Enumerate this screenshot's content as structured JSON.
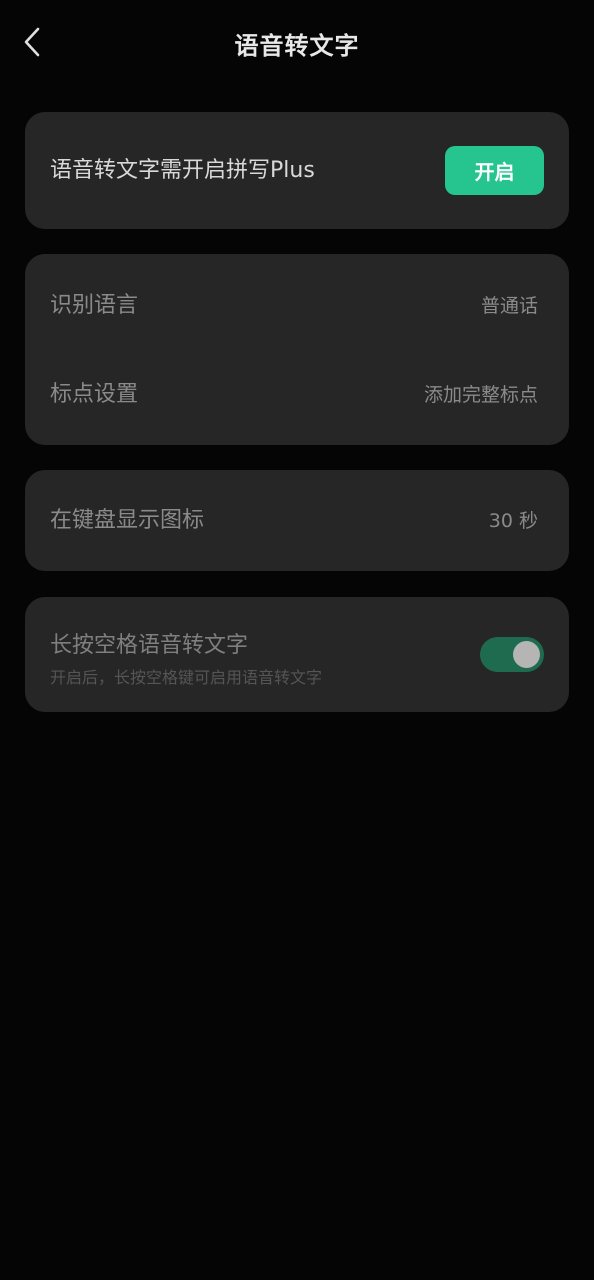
{
  "header": {
    "title": "语音转文字",
    "back_icon": "chevron-left-icon"
  },
  "plus_card": {
    "text": "语音转文字需开启拼写Plus",
    "button_label": "开启",
    "button_color": "#26c48e"
  },
  "settings": {
    "language": {
      "label": "识别语言",
      "value": "普通话"
    },
    "punctuation": {
      "label": "标点设置",
      "value": "添加完整标点"
    },
    "keyboard_icon": {
      "label": "在键盘显示图标",
      "value": "30 秒"
    }
  },
  "space_hold": {
    "title": "长按空格语音转文字",
    "subtitle": "开启后，长按空格键可启用语音转文字",
    "enabled": true,
    "toggle_color": "#1f6b50"
  }
}
